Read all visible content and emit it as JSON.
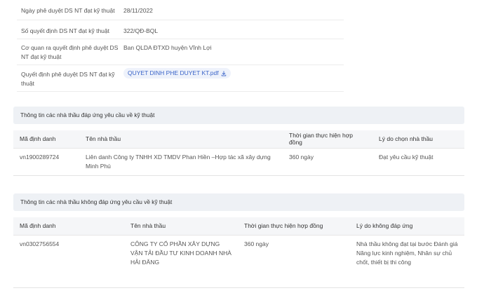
{
  "decision_info": {
    "rows": [
      {
        "label": "Ngày phê duyệt DS NT đạt kỹ thuật",
        "value": "28/11/2022"
      },
      {
        "label": "Số quyết định DS NT đạt kỹ thuật",
        "value": "322/QĐ-BQL"
      },
      {
        "label": "Cơ quan ra quyết định phê duyệt DS NT đạt kỹ thuật",
        "value": "Ban QLDA ĐTXD huyện Vĩnh Lợi"
      },
      {
        "label": "Quyết định phê duyệt DS NT đạt kỹ thuật",
        "file": "QUYET DINH PHE DUYET KT.pdf",
        "file_icon": "download-icon"
      }
    ]
  },
  "passed_section": {
    "title": "Thông tin các nhà thầu đáp ứng yêu cầu về kỹ thuật",
    "headers": [
      "Mã định danh",
      "Tên nhà thầu",
      "Thời gian thực hiện hợp đồng",
      "Lý do chọn nhà thầu"
    ],
    "rows": [
      [
        "vn1900289724",
        "Liên danh Công ty TNHH XD TMDV Phan Hiền –Hợp tác xã xây dựng Minh Phú",
        "360 ngày",
        "Đạt yêu cầu kỹ thuật"
      ]
    ]
  },
  "failed_section": {
    "title": "Thông tin các nhà thầu không đáp ứng yêu cầu về kỹ thuật",
    "headers": [
      "Mã định danh",
      "Tên nhà thầu",
      "Thời gian thực hiện hợp đồng",
      "Lý do không đáp ứng"
    ],
    "rows": [
      [
        "vn0302756554",
        "CÔNG TY CỔ PHẦN XÂY DỰNG VẬN TẢI ĐẦU TƯ KINH DOANH NHÀ HẢI ĐĂNG",
        "360 ngày",
        "Nhà thầu không đạt tại bước Đánh giá Năng lực kinh nghiệm, Nhân sự chủ chốt, thiết bị thi công"
      ]
    ]
  },
  "colors": {
    "link": "#3a64c8",
    "section_bg": "#eef1f5",
    "header_bg": "#f5f6f8"
  }
}
